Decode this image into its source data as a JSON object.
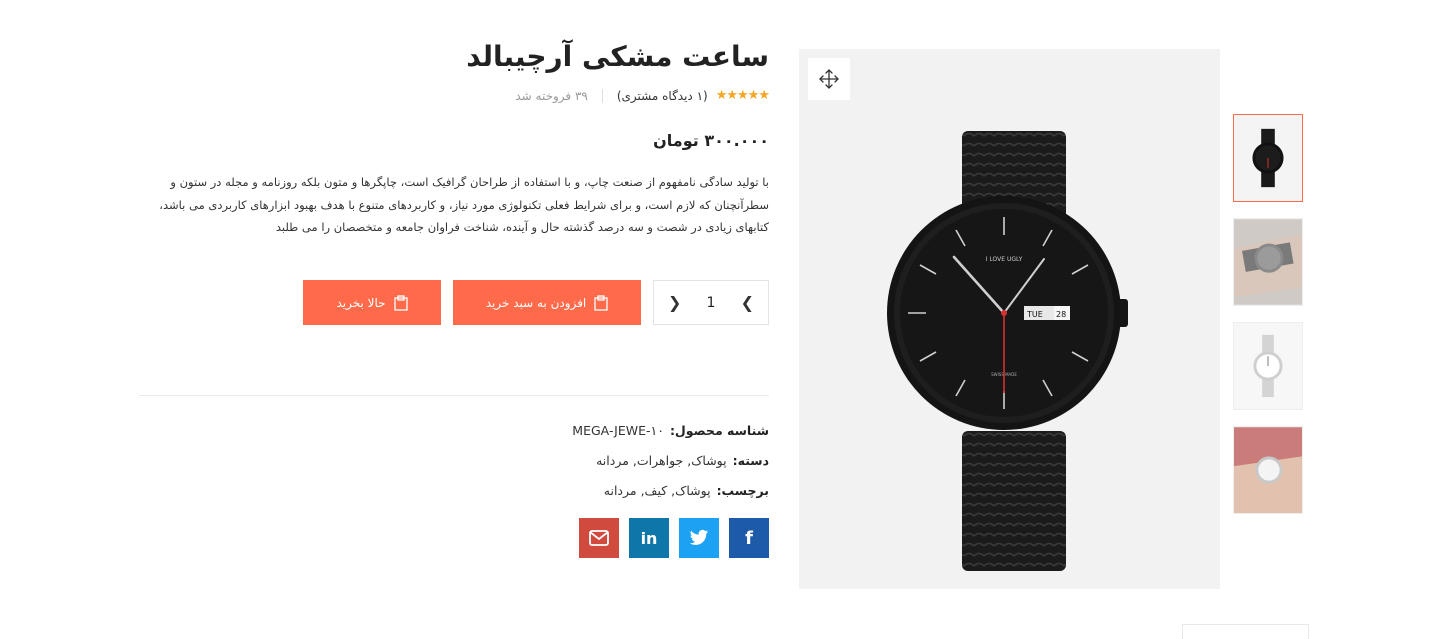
{
  "product": {
    "title": "ساعت مشکی آرچیبالد",
    "stars": "★★★★★",
    "reviews": "(۱ دیدگاه مشتری)",
    "sold": "۳۹ فروخته شد",
    "price": "۳۰۰.۰۰۰ تومان",
    "description": "با تولید سادگی نامفهوم از صنعت چاپ، و با استفاده از طراحان گرافیک است، چاپگرها و متون بلکه روزنامه و مجله در ستون و سطرآنچنان که لازم است، و برای شرایط فعلی تکنولوژی مورد نیاز، و کاربردهای متنوع با هدف بهبود ابزارهای کاربردی می باشد، کتابهای زیادی در شصت و سه درصد گذشته حال و آینده، شناخت فراوان جامعه و متخصصان را می طلبد",
    "rating_color": "#f5a623"
  },
  "cart": {
    "quantity": "1",
    "add_to_cart_label": "افزودن به سبد خرید",
    "buy_now_label": "حالا بخرید",
    "accent_color": "#ff6b4a"
  },
  "meta": {
    "sku_label": "شناسه محصول:",
    "sku_value": "MEGA-JEWE-۱۰",
    "category_label": "دسته:",
    "category_value": "پوشاک, جواهرات, مردانه",
    "tag_label": "برچسب:",
    "tag_value": "پوشاک, کیف, مردانه"
  },
  "share": {
    "facebook_icon": "facebook-icon",
    "twitter_icon": "twitter-icon",
    "linkedin_icon": "linkedin-icon",
    "email_icon": "email-icon"
  },
  "gallery": {
    "thumbnails": [
      "black-watch",
      "grey-watch-wrist",
      "silver-watch",
      "silver-watch-wrist"
    ],
    "watch_dial_text": "I LOVE UGLY",
    "watch_day": "TUE",
    "watch_date": "28",
    "watch_sub_text": "SWISS  MADE"
  }
}
